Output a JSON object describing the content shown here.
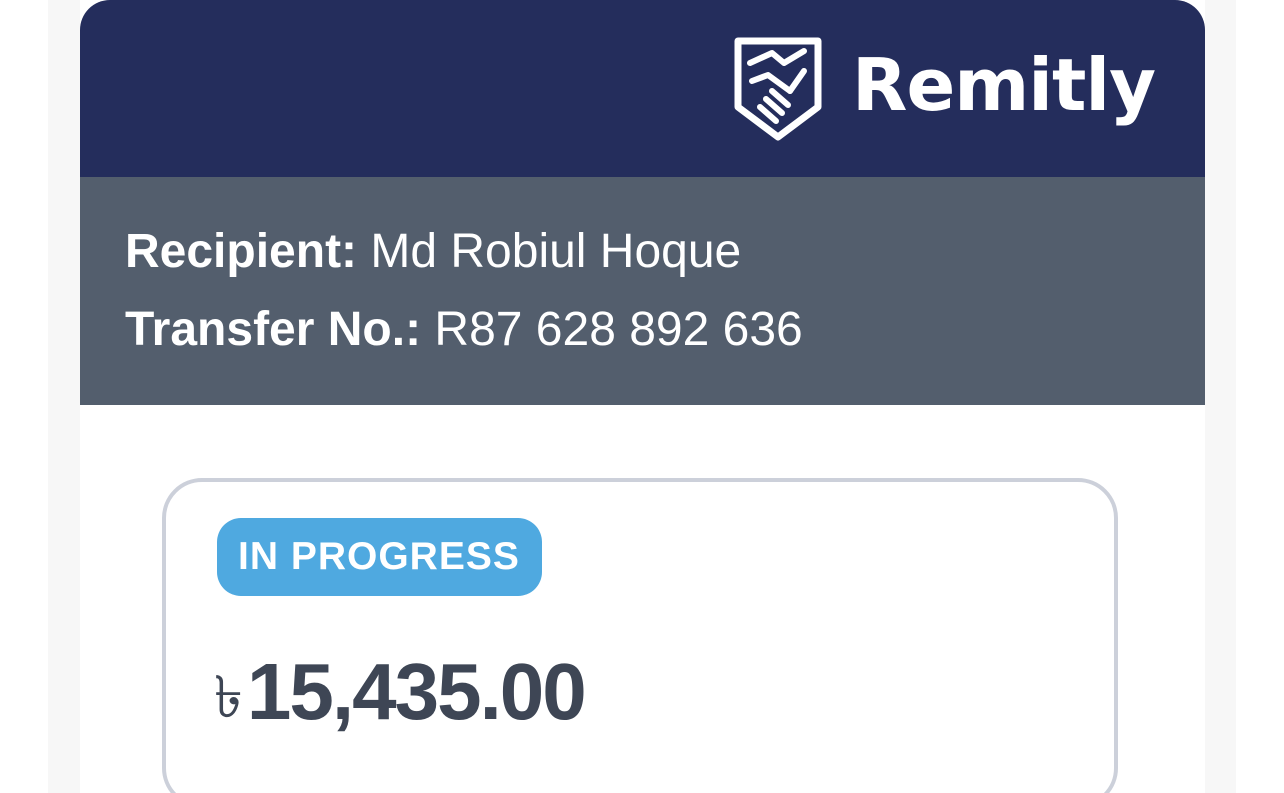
{
  "brand": {
    "name": "Remitly",
    "icon": "handshake-shield-icon",
    "header_color": "#242d5c"
  },
  "details": {
    "recipient_label": "Recipient:",
    "recipient_value": "Md Robiul Hoque",
    "transfer_label": "Transfer No.:",
    "transfer_value": "R87 628 892 636",
    "band_color": "#535e6d"
  },
  "status": {
    "badge_label": "IN PROGRESS",
    "badge_color": "#4fa9e0",
    "currency_symbol": "৳",
    "amount": "15,435.00"
  }
}
